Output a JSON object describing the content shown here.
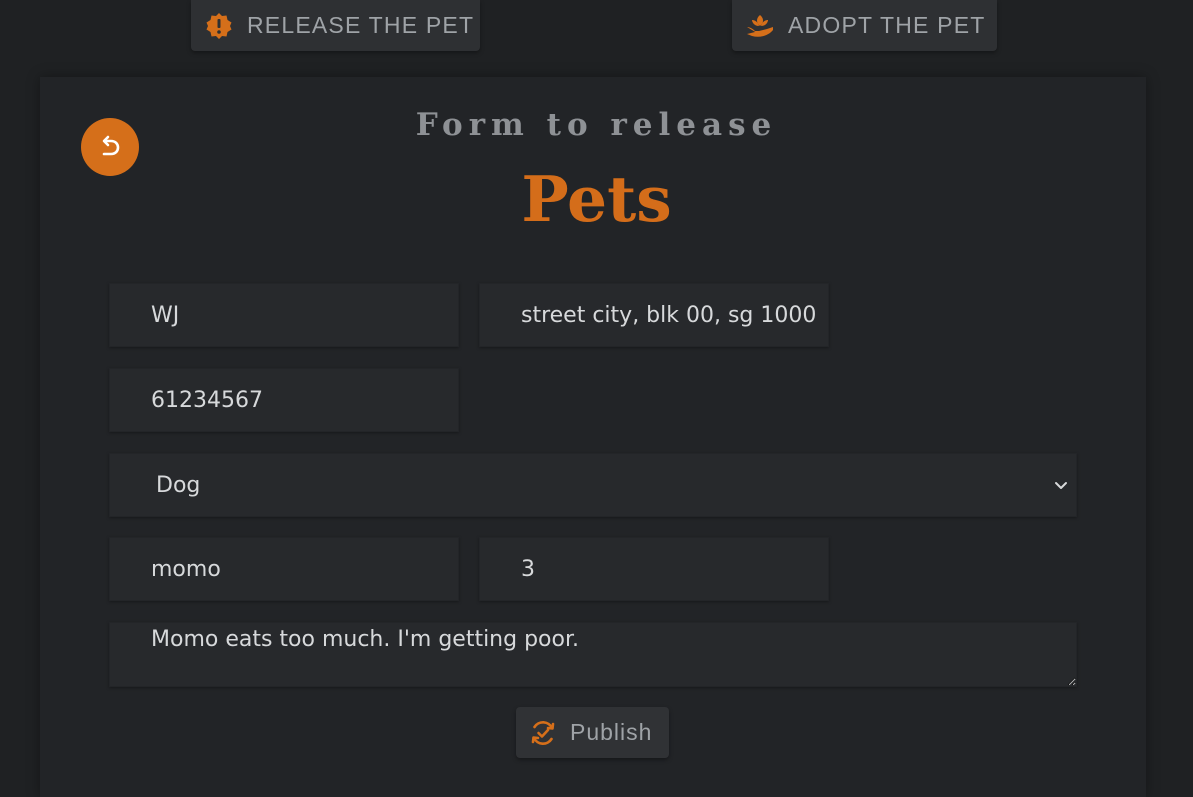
{
  "nav": {
    "release_label": "RELEASE THE PET",
    "adopt_label": "ADOPT THE PET"
  },
  "form": {
    "subtitle": "Form to release",
    "title": "Pets",
    "name_value": "WJ",
    "address_value": "street city, blk 00, sg 1000",
    "phone_value": "61234567",
    "pet_type_selected": "Dog",
    "pet_name_value": "momo",
    "pet_age_value": "3",
    "reason_value": "Momo eats too much. I'm getting poor.",
    "publish_label": "Publish"
  },
  "colors": {
    "accent": "#d46d1a",
    "background": "#1f2123",
    "card": "#222427",
    "field": "#27292c"
  },
  "icons": {
    "release": "alert-badge-icon",
    "adopt": "hand-holding-plant-icon",
    "back": "undo-arrow-icon",
    "select": "chevron-down-icon",
    "publish": "sync-check-icon"
  }
}
